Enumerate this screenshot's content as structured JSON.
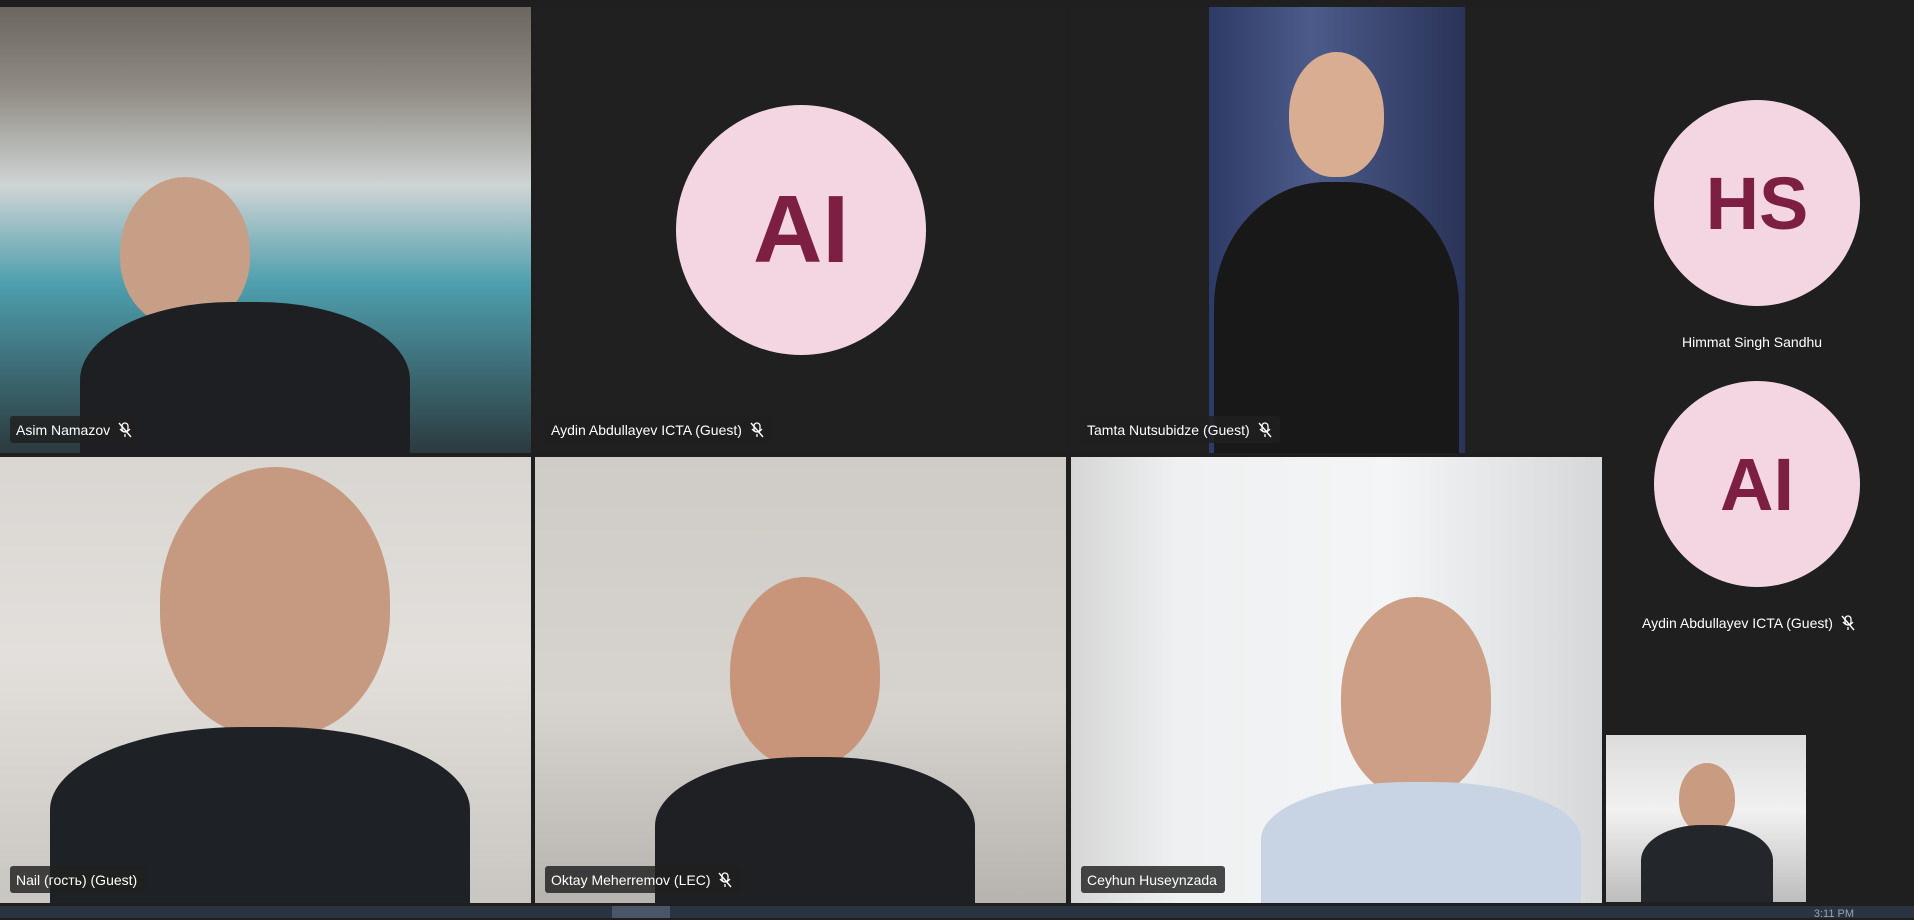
{
  "participants": [
    {
      "name": "Asim Namazov",
      "muted": true
    },
    {
      "name": "Aydin Abdullayev ICTA (Guest)",
      "initials": "AI",
      "muted": true
    },
    {
      "name": "Tamta Nutsubidze (Guest)",
      "muted": true
    },
    {
      "name": "Nail (гость) (Guest)",
      "muted": false
    },
    {
      "name": "Oktay Meherremov (LEC)",
      "muted": true
    },
    {
      "name": "Ceyhun Huseynzada",
      "muted": false
    }
  ],
  "sidebar": [
    {
      "name": "Himmat Singh Sandhu",
      "initials": "HS",
      "muted": false
    },
    {
      "name": "Aydin Abdullayev ICTA (Guest)",
      "initials": "AI",
      "muted": true
    }
  ],
  "self_view": {
    "label": ""
  },
  "clock_fragment": "3:11 PM",
  "colors": {
    "avatar_bg": "#f3d6e1",
    "avatar_text": "#7d1f43",
    "stage_bg": "#1f1f1f"
  },
  "icons": {
    "muted": "mic-off-icon"
  }
}
